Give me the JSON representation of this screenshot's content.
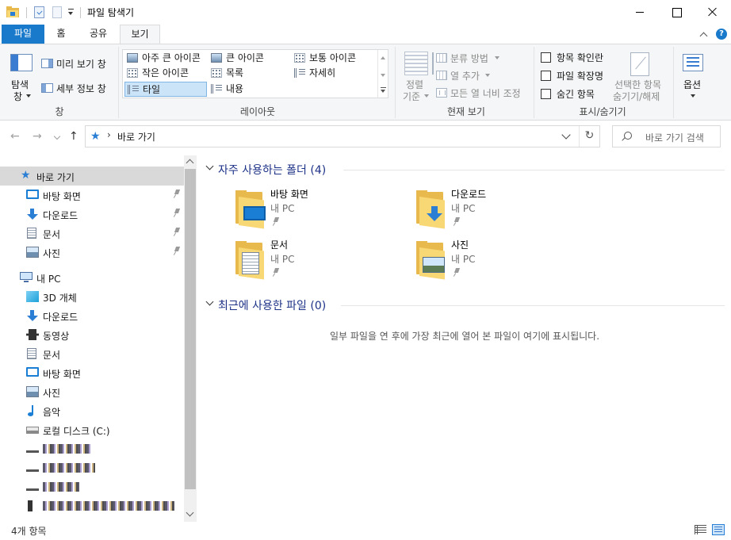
{
  "window": {
    "title": "파일 탐색기"
  },
  "ribbon_tabs": [
    "파일",
    "홈",
    "공유",
    "보기"
  ],
  "help_glyph": "?",
  "ribbon": {
    "pane_group": {
      "navigation_pane_label_1": "탐색",
      "navigation_pane_label_2": "창",
      "preview_pane": "미리 보기 창",
      "details_pane": "세부 정보 창",
      "group_label": "창"
    },
    "layout_group": {
      "items": [
        "아주 큰 아이콘",
        "큰 아이콘",
        "보통 아이콘",
        "작은 아이콘",
        "목록",
        "자세히",
        "타일",
        "내용"
      ],
      "selected": "타일",
      "group_label": "레이아웃"
    },
    "current_view_group": {
      "sort_label_1": "정렬",
      "sort_label_2": "기준",
      "group_by": "분류 방법",
      "add_columns": "열 추가",
      "size_all_columns": "모든 열 너비 조정",
      "group_label": "현재 보기"
    },
    "show_hide_group": {
      "item_check_boxes": "항목 확인란",
      "file_name_extensions": "파일 확장명",
      "hidden_items": "숨긴 항목",
      "hide_selected_1": "선택한 항목",
      "hide_selected_2": "숨기기/해제",
      "group_label": "표시/숨기기"
    },
    "options": "옵션"
  },
  "address": {
    "back_glyph": "←",
    "forward_glyph": "→",
    "up_glyph": "↑",
    "path": "바로 가기",
    "chevron": "›",
    "refresh_glyph": "↻",
    "search_placeholder": "바로 가기 검색"
  },
  "nav_pane": {
    "quick_access": {
      "label": "바로 가기",
      "items": [
        {
          "label": "바탕 화면",
          "icon": "desktop-icon",
          "pinned": true
        },
        {
          "label": "다운로드",
          "icon": "download-icon",
          "pinned": true
        },
        {
          "label": "문서",
          "icon": "document-icon",
          "pinned": true
        },
        {
          "label": "사진",
          "icon": "picture-icon",
          "pinned": true
        }
      ]
    },
    "this_pc": {
      "label": "내 PC",
      "items": [
        {
          "label": "3D 개체",
          "icon": "3d-objects-icon"
        },
        {
          "label": "다운로드",
          "icon": "download-icon"
        },
        {
          "label": "동영상",
          "icon": "video-icon"
        },
        {
          "label": "문서",
          "icon": "document-icon"
        },
        {
          "label": "바탕 화면",
          "icon": "desktop-icon"
        },
        {
          "label": "사진",
          "icon": "picture-icon"
        },
        {
          "label": "음악",
          "icon": "music-icon"
        },
        {
          "label": "로컬 디스크 (C:)",
          "icon": "local-disk-icon"
        }
      ]
    },
    "redacted_drive_count": 4
  },
  "content": {
    "frequent_header": "자주 사용하는 폴더 (4)",
    "frequent_folders": [
      {
        "name": "바탕 화면",
        "location": "내 PC",
        "icon": "desktop-folder-icon"
      },
      {
        "name": "다운로드",
        "location": "내 PC",
        "icon": "downloads-folder-icon"
      },
      {
        "name": "문서",
        "location": "내 PC",
        "icon": "documents-folder-icon"
      },
      {
        "name": "사진",
        "location": "내 PC",
        "icon": "pictures-folder-icon"
      }
    ],
    "recent_header": "최근에 사용한 파일 (0)",
    "recent_empty_message": "일부 파일을 연 후에 가장 최근에 열어 본 파일이 여기에 표시됩니다."
  },
  "status_bar": {
    "item_count": "4개 항목"
  },
  "colors": {
    "accent": "#1979ca",
    "section_header": "#1e3287",
    "folder": "#f8d775"
  }
}
